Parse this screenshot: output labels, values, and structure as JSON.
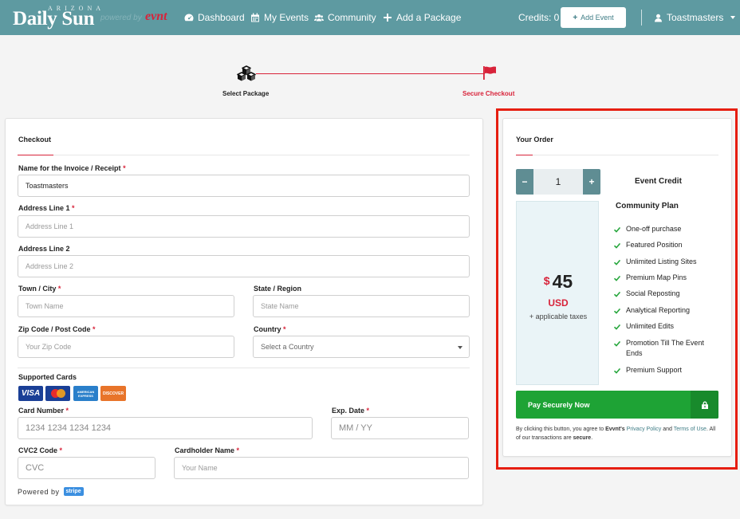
{
  "brand": {
    "top": "ARIZONA",
    "main": "Daily Sun",
    "powered": "powered by",
    "evnt": "evnt"
  },
  "nav": {
    "dashboard": "Dashboard",
    "my_events": "My Events",
    "community": "Community",
    "add_package": "Add a Package",
    "credits": "Credits: 0",
    "add_event": "Add Event",
    "user": "Toastmasters"
  },
  "stepper": {
    "step1": "Select Package",
    "step2": "Secure Checkout"
  },
  "checkout": {
    "title": "Checkout",
    "invoice_name": {
      "label": "Name for the Invoice / Receipt",
      "value": "Toastmasters"
    },
    "address1": {
      "label": "Address Line 1",
      "placeholder": "Address Line 1"
    },
    "address2": {
      "label": "Address Line 2",
      "placeholder": "Address Line 2"
    },
    "town": {
      "label": "Town / City",
      "placeholder": "Town Name"
    },
    "state": {
      "label": "State / Region",
      "placeholder": "State Name"
    },
    "zip": {
      "label": "Zip Code / Post Code",
      "placeholder": "Your Zip Code"
    },
    "country": {
      "label": "Country",
      "value": "Select a Country"
    },
    "supported_cards": "Supported Cards",
    "cards": {
      "visa": "VISA",
      "amex": "AMERICAN EXPRESS",
      "discover": "DISCOVER"
    },
    "card_number": {
      "label": "Card Number",
      "placeholder": "1234 1234 1234 1234"
    },
    "exp_date": {
      "label": "Exp. Date",
      "placeholder": "MM / YY"
    },
    "cvc": {
      "label": "CVC2 Code",
      "placeholder": "CVC"
    },
    "cardholder": {
      "label": "Cardholder Name",
      "placeholder": "Your Name"
    },
    "powered_by": "Powered by",
    "stripe": "stripe",
    "required_mark": "*"
  },
  "order": {
    "title": "Your Order",
    "quantity": "1",
    "minus": "−",
    "plus": "+",
    "currency_symbol": "$",
    "price": "45",
    "currency": "USD",
    "taxes": "+ applicable taxes",
    "item": "Event Credit",
    "plan": "Community Plan",
    "features": [
      "One-off purchase",
      "Featured Position",
      "Unlimited Listing Sites",
      "Premium Map Pins",
      "Social Reposting",
      "Analytical Reporting",
      "Unlimited Edits",
      "Promotion Till The Event Ends",
      "Premium Support"
    ],
    "pay_button": "Pay Securely Now",
    "terms": {
      "prefix": "By clicking this button, you agree to",
      "brand": "Evvnt's",
      "privacy": "Privacy Policy",
      "and": "and",
      "terms_link": "Terms of Use",
      "middle": ". All of our transactions are",
      "secure": "secure",
      "end": "."
    }
  },
  "colors": {
    "navbar": "#5e9aa1",
    "accent_red": "#d8233a",
    "pay_green": "#1ea335",
    "highlight_red": "#e61e10"
  }
}
